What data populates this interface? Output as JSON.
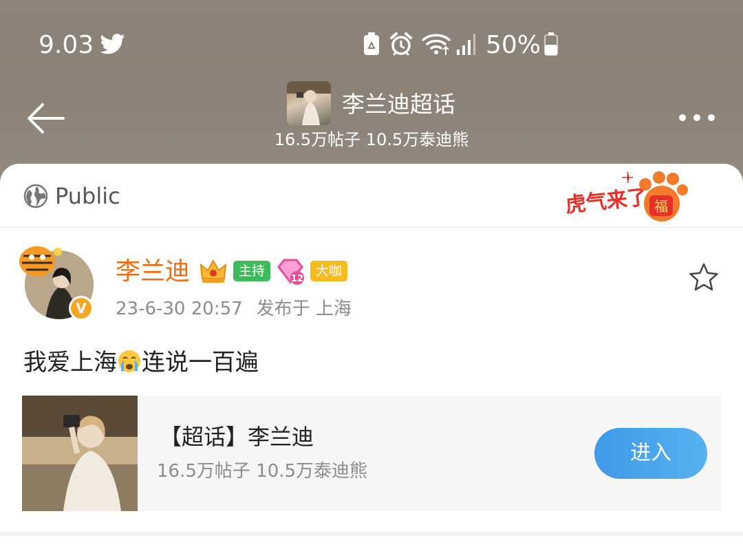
{
  "status_bar": {
    "time": "9.03",
    "battery_percent": "50%"
  },
  "header": {
    "title": "李兰迪超话",
    "stats": "16.5万帖子 10.5万泰迪熊"
  },
  "visibility": {
    "label": "Public"
  },
  "banner": {
    "text": "虎气来了",
    "badge": "福"
  },
  "post": {
    "author": "李兰迪",
    "level": "12",
    "badges": {
      "host": "主持",
      "vip": "大咖"
    },
    "verified_mark": "V",
    "timestamp": "23-6-30 20:57",
    "location": "发布于 上海",
    "text_before_emoji": "我爱上海",
    "text_after_emoji": "连说一百遍"
  },
  "topic_card": {
    "title": "【超话】李兰迪",
    "stats": "16.5万帖子 10.5万泰迪熊",
    "enter_label": "进入"
  },
  "colors": {
    "author_orange": "#f06c0c",
    "host_green": "#3cbb5c",
    "vip_yellow": "#f6bb1f",
    "enter_blue": "#3f9ae8",
    "header_brown": "#8e8378"
  }
}
